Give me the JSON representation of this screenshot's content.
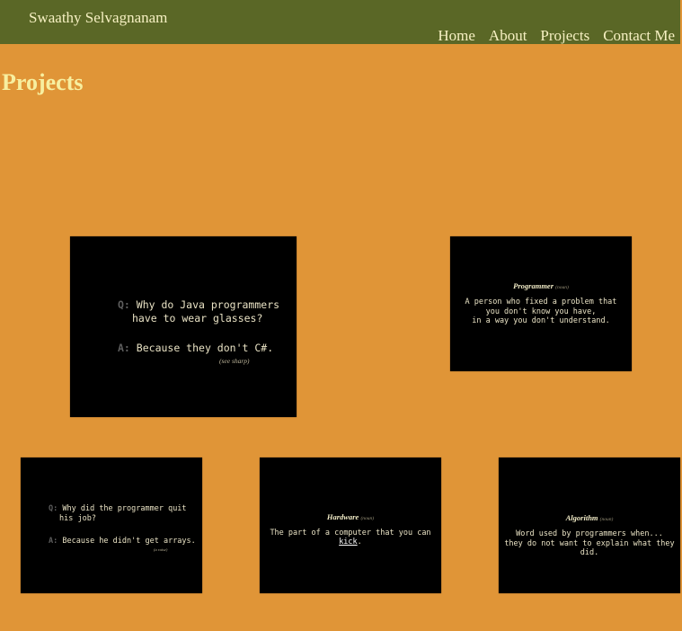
{
  "header": {
    "brand": "Swaathy Selvagnanam",
    "nav": [
      "Home",
      "About",
      "Projects",
      "Contact Me"
    ]
  },
  "page": {
    "title": "Projects"
  },
  "cards": {
    "java": {
      "q_mark": "Q:",
      "question_line1": "Why do Java programmers",
      "question_line2": "have to wear glasses?",
      "a_mark": "A:",
      "answer": "Because they don't C#.",
      "note": "(see sharp)"
    },
    "programmer": {
      "term": "Programmer",
      "pos": "(noun)",
      "line1": "A person who fixed a problem that",
      "line2": "you don't know you have,",
      "line3": "in a way you don't understand."
    },
    "arrays": {
      "q_mark": "Q:",
      "question_line1": "Why did the programmer quit",
      "question_line2": "his job?",
      "a_mark": "A:",
      "answer": "Because he didn't get arrays.",
      "note": "(a raise)"
    },
    "hardware": {
      "term": "Hardware",
      "pos": "(noun)",
      "line_prefix": "The part of a computer that you can ",
      "line_emph": "kick",
      "line_suffix": "."
    },
    "algorithm": {
      "term": "Algorithm",
      "pos": "(noun)",
      "line1": "Word used by programmers when...",
      "line2": "they do not want to explain what they did."
    }
  }
}
